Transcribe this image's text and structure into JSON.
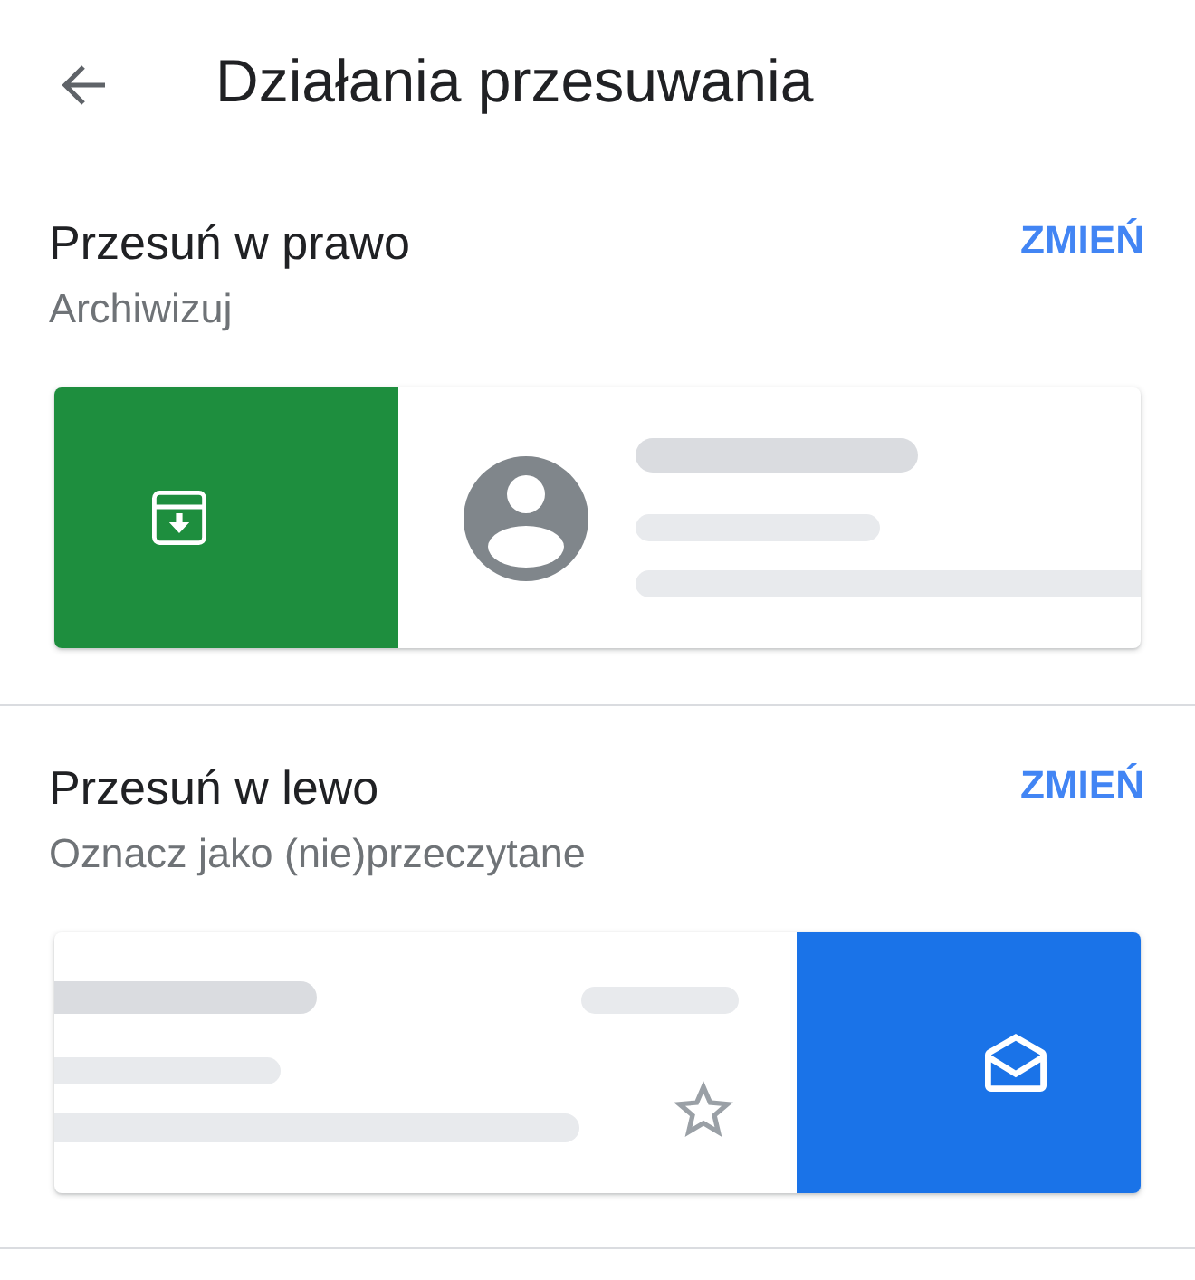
{
  "header": {
    "title": "Działania przesuwania"
  },
  "swipe_actions": [
    {
      "kind": "swipe_right",
      "title": "Przesuń w prawo",
      "action": "Archiwizuj",
      "button": "ZMIEŃ",
      "color": "#1e8e3e"
    },
    {
      "kind": "swipe_left",
      "title": "Przesuń w lewo",
      "action": "Oznacz jako (nie)przeczytane",
      "button": "ZMIEŃ",
      "color": "#1a73e8"
    }
  ]
}
